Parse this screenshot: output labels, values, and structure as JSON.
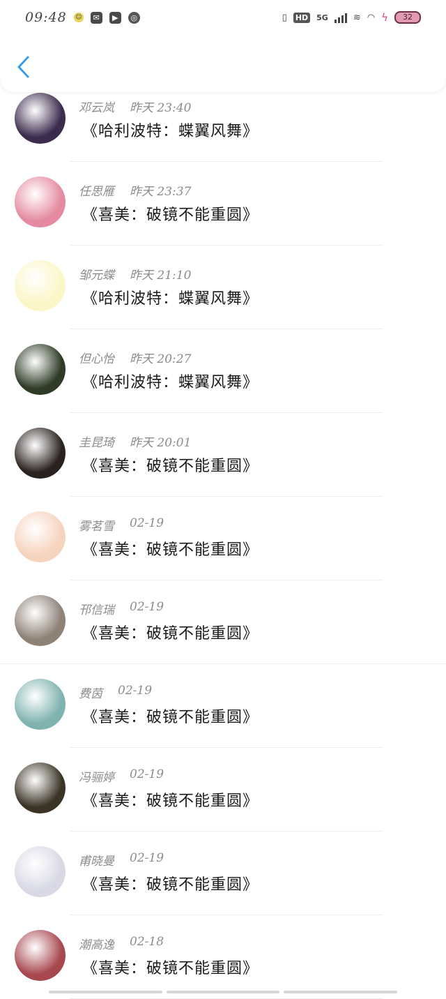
{
  "status": {
    "time": "09:48",
    "network": "5G",
    "hd": "HD",
    "battery": "32"
  },
  "items": [
    {
      "name": "邓云岚",
      "time": "昨天 23:40",
      "book": "《哈利波特：蝶翼风舞》",
      "avatar_color": "#3b2b4d"
    },
    {
      "name": "任思雁",
      "time": "昨天 23:37",
      "book": "《喜美：破镜不能重圆》",
      "avatar_color": "#e58aa0"
    },
    {
      "name": "邹元蝶",
      "time": "昨天 21:10",
      "book": "《哈利波特：蝶翼风舞》",
      "avatar_color": "#fbf6c7"
    },
    {
      "name": "但心怡",
      "time": "昨天 20:27",
      "book": "《哈利波特：蝶翼风舞》",
      "avatar_color": "#2e3b26"
    },
    {
      "name": "圭昆琦",
      "time": "昨天 20:01",
      "book": "《喜美：破镜不能重圆》",
      "avatar_color": "#2a221f"
    },
    {
      "name": "雾茗雪",
      "time": "02-19",
      "book": "《喜美：破镜不能重圆》",
      "avatar_color": "#f6d3bd"
    },
    {
      "name": "邗信瑞",
      "time": "02-19",
      "book": "《喜美：破镜不能重圆》",
      "avatar_color": "#8e8176"
    },
    {
      "name": "费茵",
      "time": "02-19",
      "book": "《喜美：破镜不能重圆》",
      "avatar_color": "#7fb3b0"
    },
    {
      "name": "冯骊婷",
      "time": "02-19",
      "book": "《喜美：破镜不能重圆》",
      "avatar_color": "#3b3426"
    },
    {
      "name": "甫晓曼",
      "time": "02-19",
      "book": "《喜美：破镜不能重圆》",
      "avatar_color": "#d9d9e6"
    },
    {
      "name": "潮高逸",
      "time": "02-18",
      "book": "《喜美：破镜不能重圆》",
      "avatar_color": "#a7484f"
    }
  ]
}
